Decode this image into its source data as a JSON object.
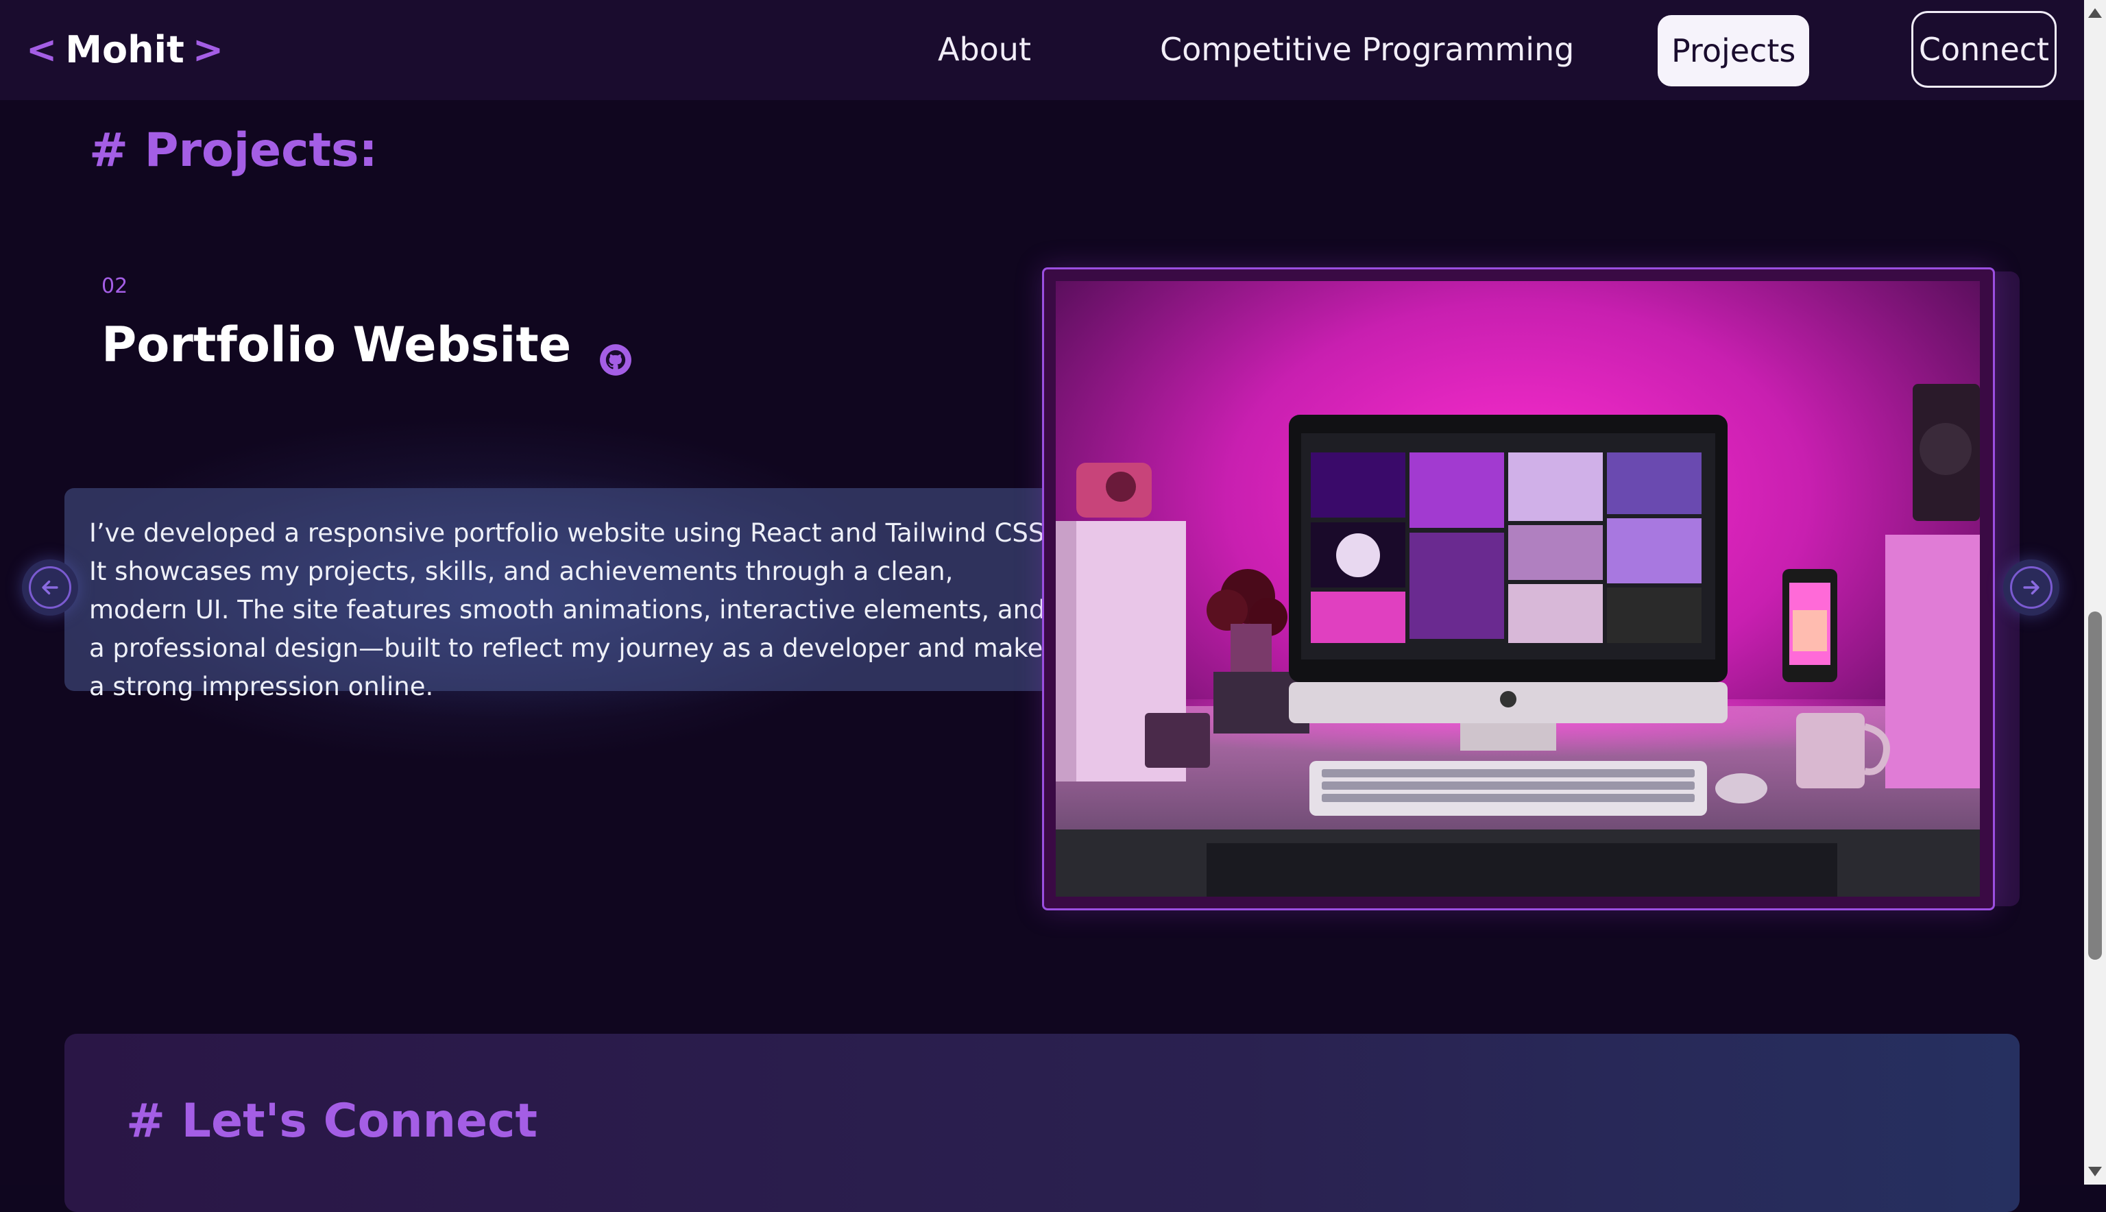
{
  "nav": {
    "logo_open": "<",
    "logo_name": "Mohit",
    "logo_close": ">",
    "links": [
      {
        "label": "About"
      },
      {
        "label": "Competitive Programming"
      },
      {
        "label": "Projects",
        "active": true
      },
      {
        "label": "Connect"
      }
    ]
  },
  "projects": {
    "section_title": "# Projects:",
    "current": {
      "number": "02",
      "title": "Portfolio Website",
      "description": "I’ve developed a responsive portfolio website using React and Tailwind CSS. It showcases my projects, skills, and achievements through a clean, modern UI. The site features smooth animations, interactive elements, and a professional design—built to reflect my journey as a developer and make a strong impression online."
    },
    "prev_icon": "arrow-left-icon",
    "next_icon": "arrow-right-icon",
    "github_icon": "github-icon"
  },
  "connect": {
    "section_title": "# Let's Connect"
  },
  "colors": {
    "accent": "#a45ee5",
    "background": "#10061f",
    "navbar": "#1a0c2e",
    "card": "#424e82"
  }
}
